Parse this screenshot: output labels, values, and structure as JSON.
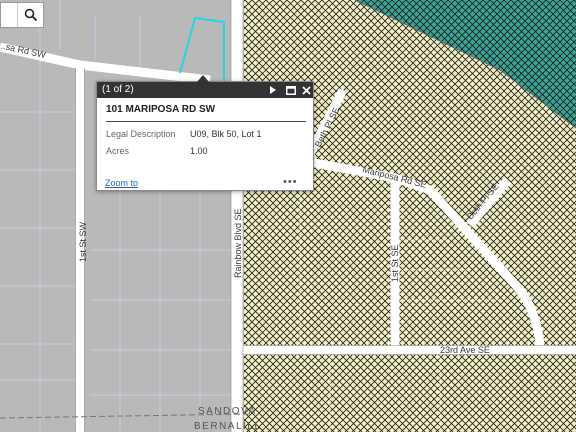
{
  "map": {
    "road_labels": {
      "mariposa_sw": "...sa Rd SW",
      "first_st_sw": "1st St SW",
      "rainbow_blvd": "Rainbow Blvd SE",
      "beth_pl_se_upper": "Beth Pl SE",
      "mariposa_se": "Mariposa Rd SE",
      "beth_pl_se_lower": "Beth Pl SE",
      "first_st_se": "1st St SE",
      "twenty_third_ave": "23rd Ave SE"
    },
    "boundary_labels": {
      "sandoval": "SANDOVA",
      "bernalillo": "BERNALILL"
    },
    "colors": {
      "base_parcels": "#b9b9b9",
      "zone_yellow": "#f4f1c4",
      "zone_teal": "#3aa597",
      "hatch": "#1a1a1a",
      "road": "#ffffff",
      "parcel_line": "#c8cbe6",
      "selected_outline": "#1fd6e8"
    }
  },
  "search": {
    "icon": "search-icon"
  },
  "popup": {
    "count": "(1 of 2)",
    "title": "101 MARIPOSA RD SW",
    "fields": [
      {
        "label": "Legal Description",
        "value": "U09, Blk 50, Lot 1"
      },
      {
        "label": "Acres",
        "value": "1.00"
      }
    ],
    "zoom_link": "Zoom to",
    "more": "•••",
    "controls": [
      "next-icon",
      "maximize-icon",
      "close-icon"
    ]
  }
}
